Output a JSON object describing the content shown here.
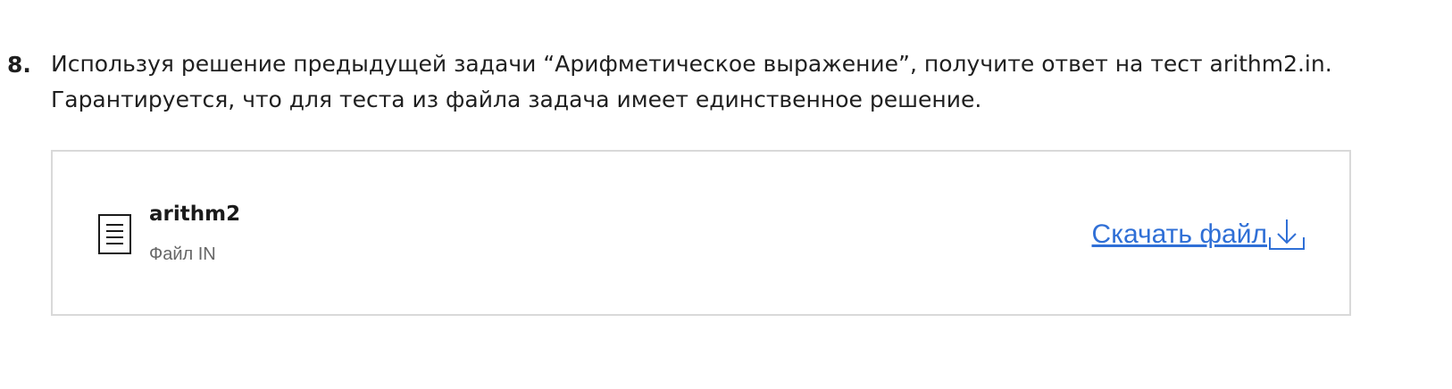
{
  "task": {
    "number": "8.",
    "text_line1": "Используя решение предыдущей задачи “Арифметическое выражение”, получите ответ на тест arithm2.in.",
    "text_line2": "Гарантируется, что для теста из файла задача имеет единственное решение."
  },
  "file": {
    "icon": "document-icon",
    "name": "arithm2",
    "type": "Файл IN",
    "download_label": "Скачать файл",
    "download_icon": "download-arrow-icon"
  },
  "colors": {
    "text": "#1f1f1f",
    "muted": "#666666",
    "link": "#2f6fd6",
    "border": "#d9d9d9"
  }
}
